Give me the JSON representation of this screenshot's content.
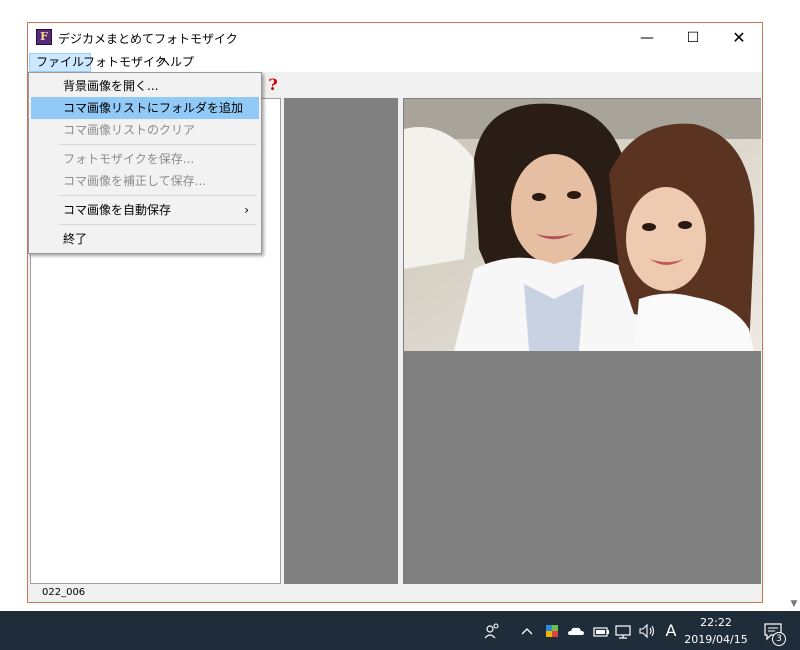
{
  "window": {
    "title": "デジカメまとめてフォトモザイク",
    "app_icon_letter": "F",
    "minimize_symbol": "—",
    "maximize_symbol": "☐",
    "close_symbol": "✕"
  },
  "menubar": {
    "items": [
      {
        "label": "ファイル"
      },
      {
        "label": "フォトモザイク"
      },
      {
        "label": "ヘルプ"
      }
    ]
  },
  "toolbar": {
    "help_icon_glyph": "?"
  },
  "file_menu": {
    "items": [
      {
        "label": "背景画像を開く...",
        "enabled": true
      },
      {
        "label": "コマ画像リストにフォルダを追加",
        "enabled": true,
        "highlighted": true
      },
      {
        "label": "コマ画像リストのクリア",
        "enabled": false
      },
      {
        "label": "フォトモザイクを保存...",
        "enabled": false
      },
      {
        "label": "コマ画像を補正して保存...",
        "enabled": false
      },
      {
        "label": "コマ画像を自動保存",
        "enabled": true,
        "submenu_arrow": "›"
      },
      {
        "label": "終了",
        "enabled": true
      }
    ]
  },
  "statusbar": {
    "text": "022_006"
  },
  "taskbar": {
    "time": "22:22",
    "date": "2019/04/15",
    "ime_indicator": "A",
    "notification_count": "3",
    "icons": [
      "people-icon",
      "chevron-up-icon",
      "security-icon",
      "onedrive-cloud-icon",
      "battery-icon",
      "network-icon",
      "volume-icon"
    ]
  },
  "colors": {
    "menu_highlight": "#91c9f7",
    "pane_gray": "#808080",
    "window_border": "#c8785a",
    "taskbar": "#1f2d3a"
  }
}
